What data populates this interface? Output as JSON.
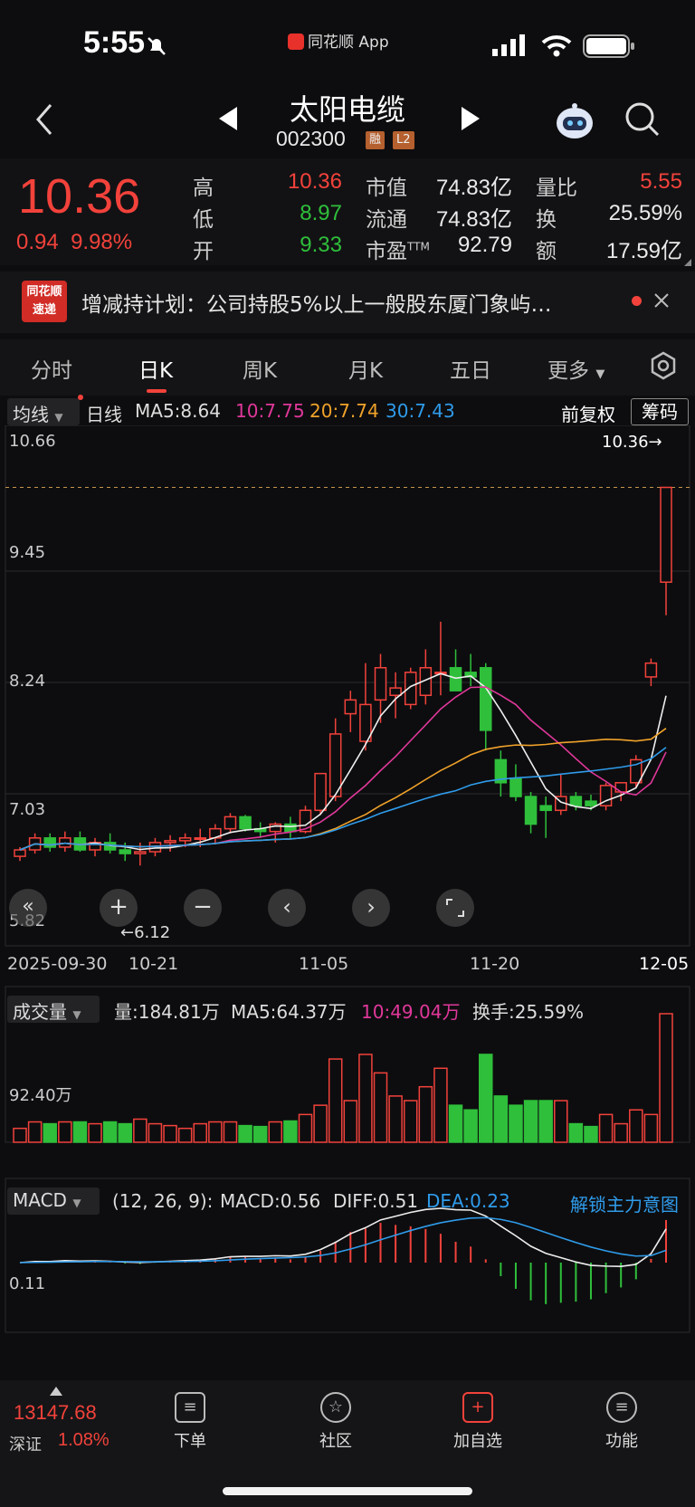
{
  "status": {
    "time": "5:55",
    "app_label": "同花顺 App"
  },
  "header": {
    "title": "太阳电缆",
    "code": "002300",
    "tag1": "融",
    "tag2": "L2"
  },
  "quote": {
    "price": "10.36",
    "change": "0.94",
    "change_pct": "9.98%",
    "high_label": "高",
    "high": "10.36",
    "low_label": "低",
    "low": "8.97",
    "open_label": "开",
    "open": "9.33",
    "mcap_label": "市值",
    "mcap": "74.83亿",
    "float_label": "流通",
    "float": "74.83亿",
    "pe_label": "市盈",
    "pe_sup": "TTM",
    "pe": "92.79",
    "vr_label": "量比",
    "vr": "5.55",
    "turn_label": "换",
    "turn": "25.59%",
    "amt_label": "额",
    "amt": "17.59亿"
  },
  "news": {
    "logo_top": "同花顺",
    "logo_bottom": "速递",
    "text": "增减持计划：公司持股5%以上一般股东厦门象屿…"
  },
  "tabs": [
    "分时",
    "日K",
    "周K",
    "月K",
    "五日",
    "更多"
  ],
  "kbar": {
    "selector": "均线",
    "type": "日线",
    "ma5": "MA5:8.64",
    "ma10": "10:7.75",
    "ma20": "20:7.74",
    "ma30": "30:7.43",
    "adjust": "前复权",
    "chips": "筹码"
  },
  "kchart": {
    "y_labels": [
      "10.66",
      "9.45",
      "8.24",
      "7.03",
      "5.82"
    ],
    "last_marker": "10.36→",
    "low_marker": "←6.12",
    "x_labels": [
      "2025-09-30",
      "10-21",
      "11-05",
      "11-20",
      "12-05"
    ]
  },
  "volbar": {
    "selector": "成交量",
    "vol": "量:184.81万",
    "ma5": "MA5:64.37万",
    "ma10": "10:49.04万",
    "turnover": "换手:25.59%",
    "y_label": "92.40万"
  },
  "macdbar": {
    "selector": "MACD",
    "params": "(12, 26, 9):",
    "macd": "MACD:0.56",
    "diff": "DIFF:0.51",
    "dea": "DEA:0.23",
    "unlock": "解锁主力意图",
    "y_label": "0.11"
  },
  "bottom": {
    "index_value": "13147.68",
    "index_name": "深证",
    "index_pct": "1.08%",
    "nav": [
      "下单",
      "社区",
      "加自选",
      "功能"
    ]
  },
  "colors": {
    "up": "#f2423b",
    "down": "#2fbf3b",
    "ma5": "#eeeeee",
    "ma10": "#e0389a",
    "ma20": "#f0a22a",
    "ma30": "#2f9bea"
  },
  "chart_data": {
    "type": "candlestick",
    "ylim": [
      5.82,
      10.66
    ],
    "candles": [
      [
        6.35,
        6.45,
        6.3,
        6.42
      ],
      [
        6.42,
        6.6,
        6.38,
        6.55
      ],
      [
        6.55,
        6.6,
        6.4,
        6.45
      ],
      [
        6.45,
        6.62,
        6.4,
        6.55
      ],
      [
        6.55,
        6.62,
        6.4,
        6.42
      ],
      [
        6.42,
        6.55,
        6.35,
        6.5
      ],
      [
        6.5,
        6.6,
        6.38,
        6.42
      ],
      [
        6.42,
        6.5,
        6.3,
        6.38
      ],
      [
        6.38,
        6.5,
        6.25,
        6.4
      ],
      [
        6.4,
        6.55,
        6.35,
        6.5
      ],
      [
        6.5,
        6.58,
        6.4,
        6.52
      ],
      [
        6.52,
        6.6,
        6.45,
        6.55
      ],
      [
        6.55,
        6.65,
        6.45,
        6.55
      ],
      [
        6.55,
        6.7,
        6.48,
        6.65
      ],
      [
        6.65,
        6.82,
        6.6,
        6.78
      ],
      [
        6.78,
        6.8,
        6.62,
        6.65
      ],
      [
        6.65,
        6.72,
        6.55,
        6.62
      ],
      [
        6.62,
        6.72,
        6.5,
        6.7
      ],
      [
        6.7,
        6.78,
        6.55,
        6.62
      ],
      [
        6.62,
        6.9,
        6.6,
        6.85
      ],
      [
        6.85,
        7.2,
        6.8,
        7.25
      ],
      [
        7.0,
        7.85,
        6.95,
        7.68
      ],
      [
        7.9,
        8.15,
        7.7,
        8.05
      ],
      [
        7.6,
        8.45,
        7.5,
        8.0
      ],
      [
        8.05,
        8.55,
        7.8,
        8.4
      ],
      [
        8.1,
        8.35,
        7.85,
        8.18
      ],
      [
        8.0,
        8.4,
        7.95,
        8.35
      ],
      [
        8.1,
        8.6,
        8.0,
        8.4
      ],
      [
        8.35,
        8.9,
        8.1,
        8.35
      ],
      [
        8.4,
        8.6,
        8.2,
        8.15
      ],
      [
        8.35,
        8.55,
        8.2,
        8.3
      ],
      [
        8.4,
        8.45,
        7.5,
        7.72
      ],
      [
        7.4,
        7.5,
        7.0,
        7.15
      ],
      [
        7.2,
        7.35,
        6.95,
        7.0
      ],
      [
        7.0,
        7.05,
        6.6,
        6.7
      ],
      [
        6.9,
        7.0,
        6.55,
        6.85
      ],
      [
        6.85,
        7.25,
        6.8,
        7.0
      ],
      [
        7.0,
        7.05,
        6.85,
        6.9
      ],
      [
        6.95,
        7.02,
        6.85,
        6.9
      ],
      [
        6.9,
        7.15,
        6.85,
        7.12
      ],
      [
        7.05,
        7.15,
        6.95,
        7.15
      ],
      [
        7.15,
        7.45,
        7.1,
        7.4
      ],
      [
        8.3,
        8.5,
        8.2,
        8.45
      ],
      [
        9.33,
        10.36,
        8.97,
        10.36
      ]
    ]
  }
}
